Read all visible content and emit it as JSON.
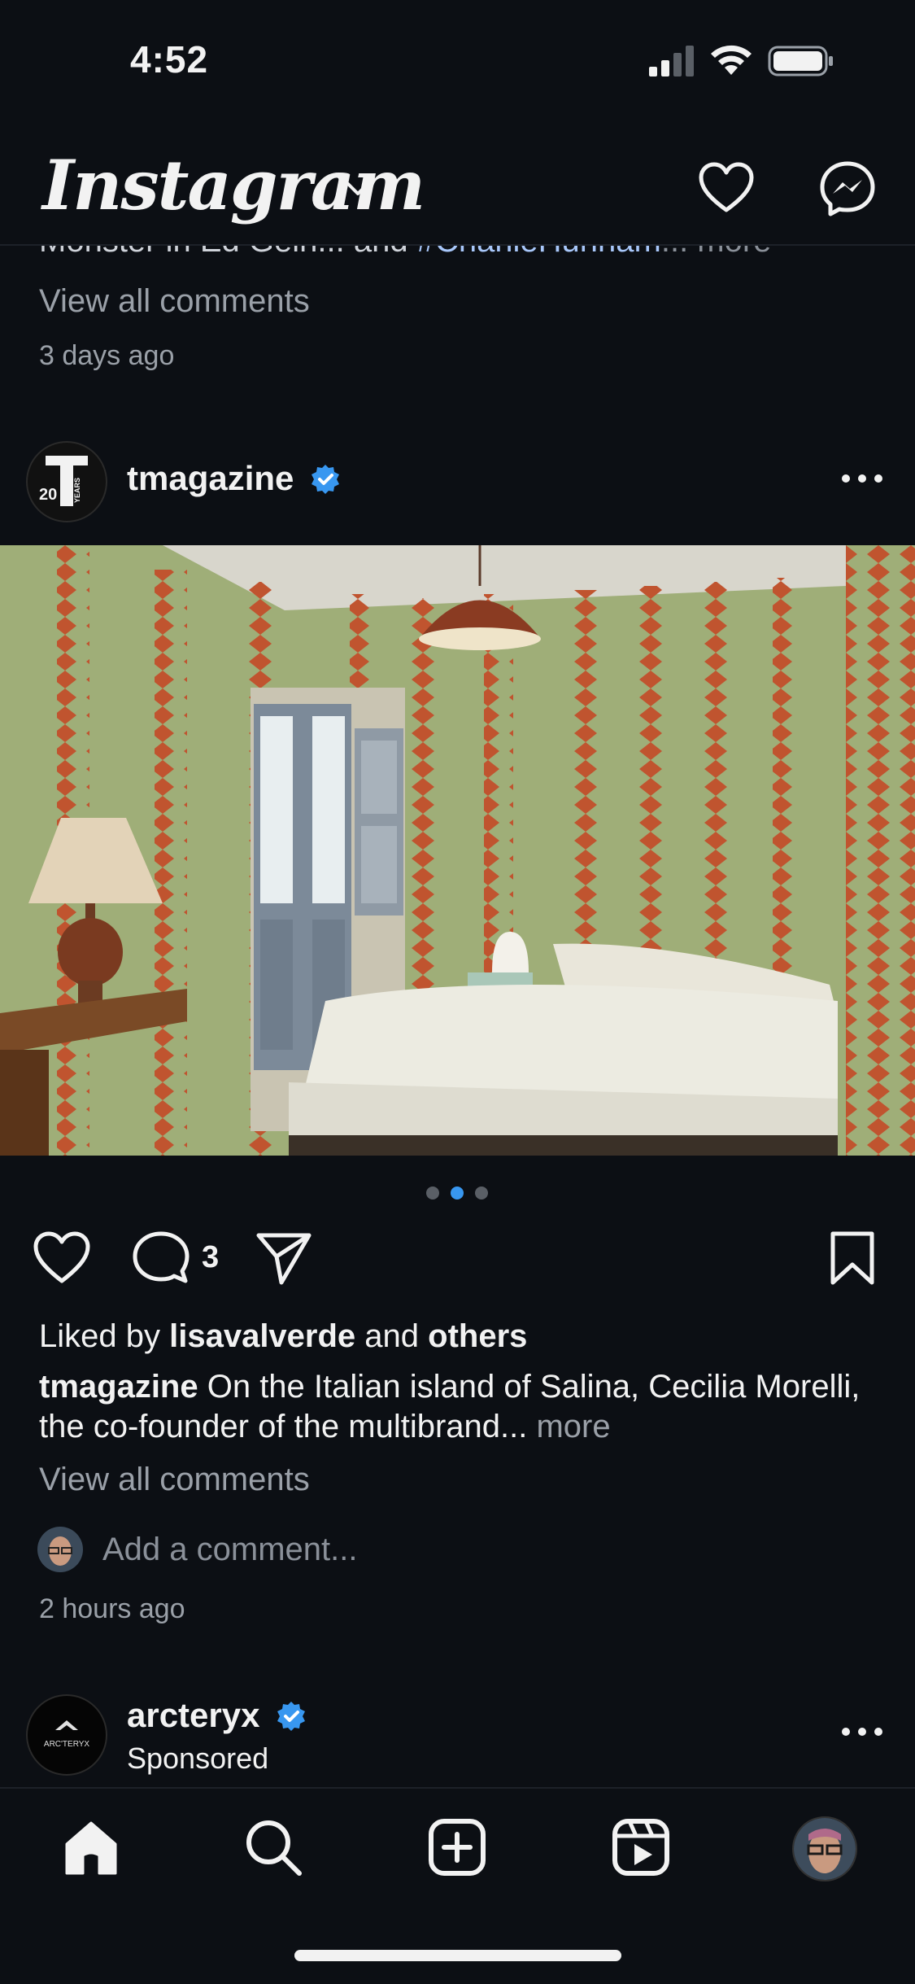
{
  "status_bar": {
    "time": "4:52"
  },
  "header": {
    "logo": "Instagram"
  },
  "prev_post": {
    "caption_start": "Monster in Ed Gein... and ",
    "caption_tag": "#CharlieHunnam",
    "caption_more": "... more",
    "view_all_comments": "View all comments",
    "time_ago": "3 days ago"
  },
  "post": {
    "username": "tmagazine",
    "avatar_text_main": "20",
    "avatar_text_side": "YEARS",
    "comment_count": "3",
    "liked_prefix": "Liked by ",
    "liked_user": "lisavalverde",
    "liked_mid": " and ",
    "liked_others": "others",
    "caption_user": "tmagazine",
    "caption_text": " On the Italian island of Salina, Cecilia Morelli, the co-founder of the multibrand...",
    "caption_more": " more",
    "view_all_comments": "View all comments",
    "add_comment_placeholder": "Add a comment...",
    "time_ago": "2 hours ago",
    "carousel_index": 2,
    "carousel_total": 3
  },
  "next_post": {
    "username": "arcteryx",
    "label": "Sponsored",
    "avatar_text": "ARC'TERYX"
  },
  "nav": {
    "items": [
      "home-icon",
      "search-icon",
      "create-icon",
      "reels-icon",
      "profile-avatar"
    ]
  },
  "colors": {
    "background": "#0c0f14",
    "accent": "#3897f0",
    "hashtag": "#a8c7fa"
  }
}
